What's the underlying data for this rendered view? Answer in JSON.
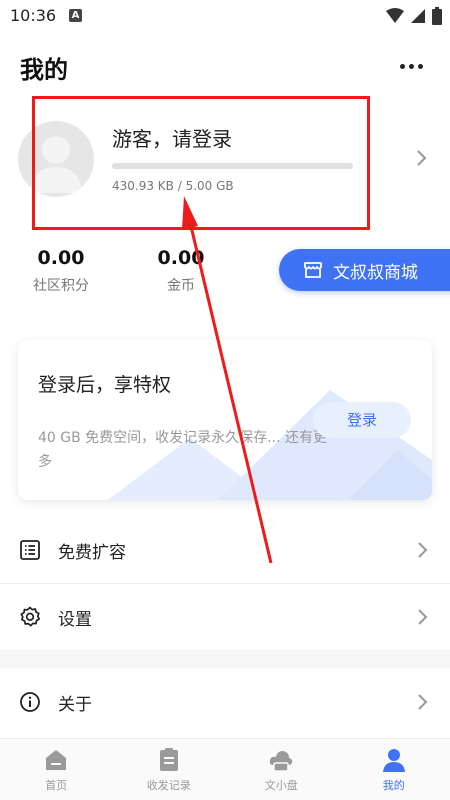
{
  "status_bar": {
    "time": "10:36",
    "notification_icon": "A"
  },
  "header": {
    "title": "我的",
    "more_icon": "more-horizontal-icon"
  },
  "profile": {
    "guest_text": "游客，请登录",
    "storage_text": "430.93 KB / 5.00 GB",
    "storage_used_fraction": 0.0001
  },
  "stats": [
    {
      "value": "0.00",
      "label": "社区积分"
    },
    {
      "value": "0.00",
      "label": "金币"
    }
  ],
  "shop_button": {
    "label": "文叔叔商城",
    "icon": "store-icon"
  },
  "login_card": {
    "title": "登录后，享特权",
    "description": "40 GB 免费空间，收发记录永久保存... 还有更多",
    "button": "登录"
  },
  "menu": [
    {
      "label": "免费扩容",
      "icon": "list-icon"
    },
    {
      "label": "设置",
      "icon": "gear-icon"
    },
    {
      "label": "关于",
      "icon": "info-icon"
    }
  ],
  "tabs": [
    {
      "label": "首页",
      "icon": "home-icon",
      "active": false
    },
    {
      "label": "收发记录",
      "icon": "clipboard-icon",
      "active": false
    },
    {
      "label": "文小盘",
      "icon": "cloud-disk-icon",
      "active": false
    },
    {
      "label": "我的",
      "icon": "person-icon",
      "active": true
    }
  ],
  "colors": {
    "accent": "#3f73f3",
    "annotation": "#ee1b1b"
  }
}
